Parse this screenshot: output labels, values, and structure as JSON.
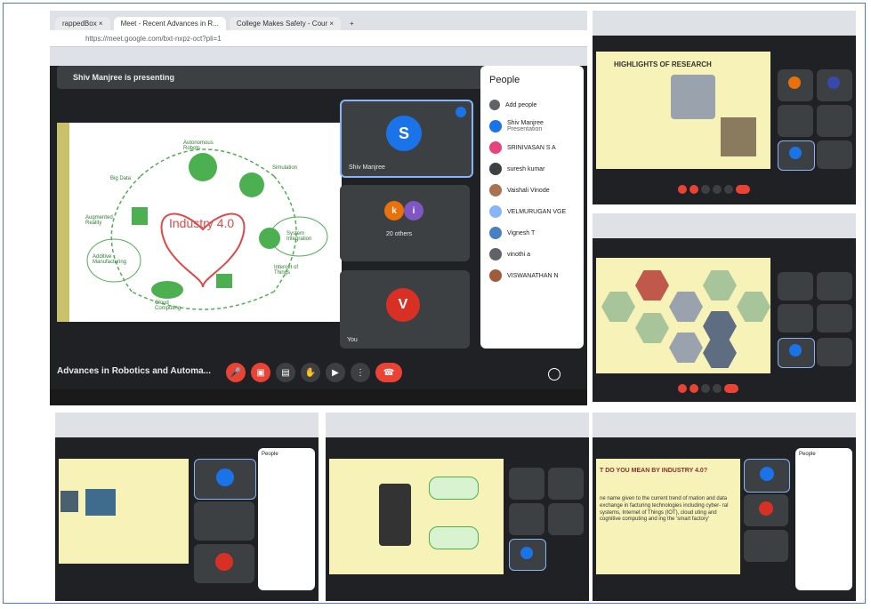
{
  "main": {
    "tabs": [
      "rappedBox ×",
      "Meet - Recent Advances in R...",
      "College Makes Safety - Cour ×",
      "+"
    ],
    "url": "https://meet.google.com/bxt-nxpz-oct?pli=1",
    "presenter_banner": "Shiv Manjree is presenting",
    "slide_center": "Industry 4.0",
    "slide_nodes": [
      "Autonomous Robots",
      "Simulation",
      "System Integration",
      "Internet of Things",
      "Cloud Computing",
      "Additive Manufacturing",
      "Augmented Reality",
      "Big Data"
    ],
    "tiles": [
      {
        "letter": "S",
        "name": "Shiv Manjree",
        "color": "#1a73e8"
      },
      {
        "letters": [
          "k",
          "i"
        ],
        "name": "20 others"
      },
      {
        "letter": "V",
        "name": "You",
        "color": "#d93025"
      }
    ],
    "meeting_title": "Advances in Robotics and Automa...",
    "people_title": "People",
    "add_people": "Add people",
    "people": [
      {
        "name": "Shiv Manjree",
        "sub": "Presentation",
        "color": "#1a73e8"
      },
      {
        "name": "SRINIVASAN S A",
        "sub": "",
        "color": "#e8437a"
      },
      {
        "name": "suresh kumar",
        "sub": "",
        "color": "#3c4043"
      },
      {
        "name": "Vaishali Vinode",
        "sub": "",
        "color": "#a8734e"
      },
      {
        "name": "VELMURUGAN VGE",
        "sub": "",
        "color": "#8ab4f8"
      },
      {
        "name": "Vignesh T",
        "sub": "",
        "color": "#4a7fc1"
      },
      {
        "name": "vinothi a",
        "sub": "",
        "color": "#5f6368"
      },
      {
        "name": "VISWANATHAN N",
        "sub": "",
        "color": "#a15c3c"
      }
    ]
  },
  "panel_tr": {
    "slide_title": "HIGHLIGHTS OF RESEARCH"
  },
  "panel_br": {
    "slide_title": "T DO YOU MEAN BY INDUSTRY 4.0?",
    "body": "ne name given to the current trend of mation and data exchange in facturing technologies including cyber- ral systems, Internet of Things (IOT), cloud uting and cognitive computing and ing the 'smart factory'",
    "people_title": "People"
  },
  "panel_bl": {
    "people_title": "People"
  }
}
